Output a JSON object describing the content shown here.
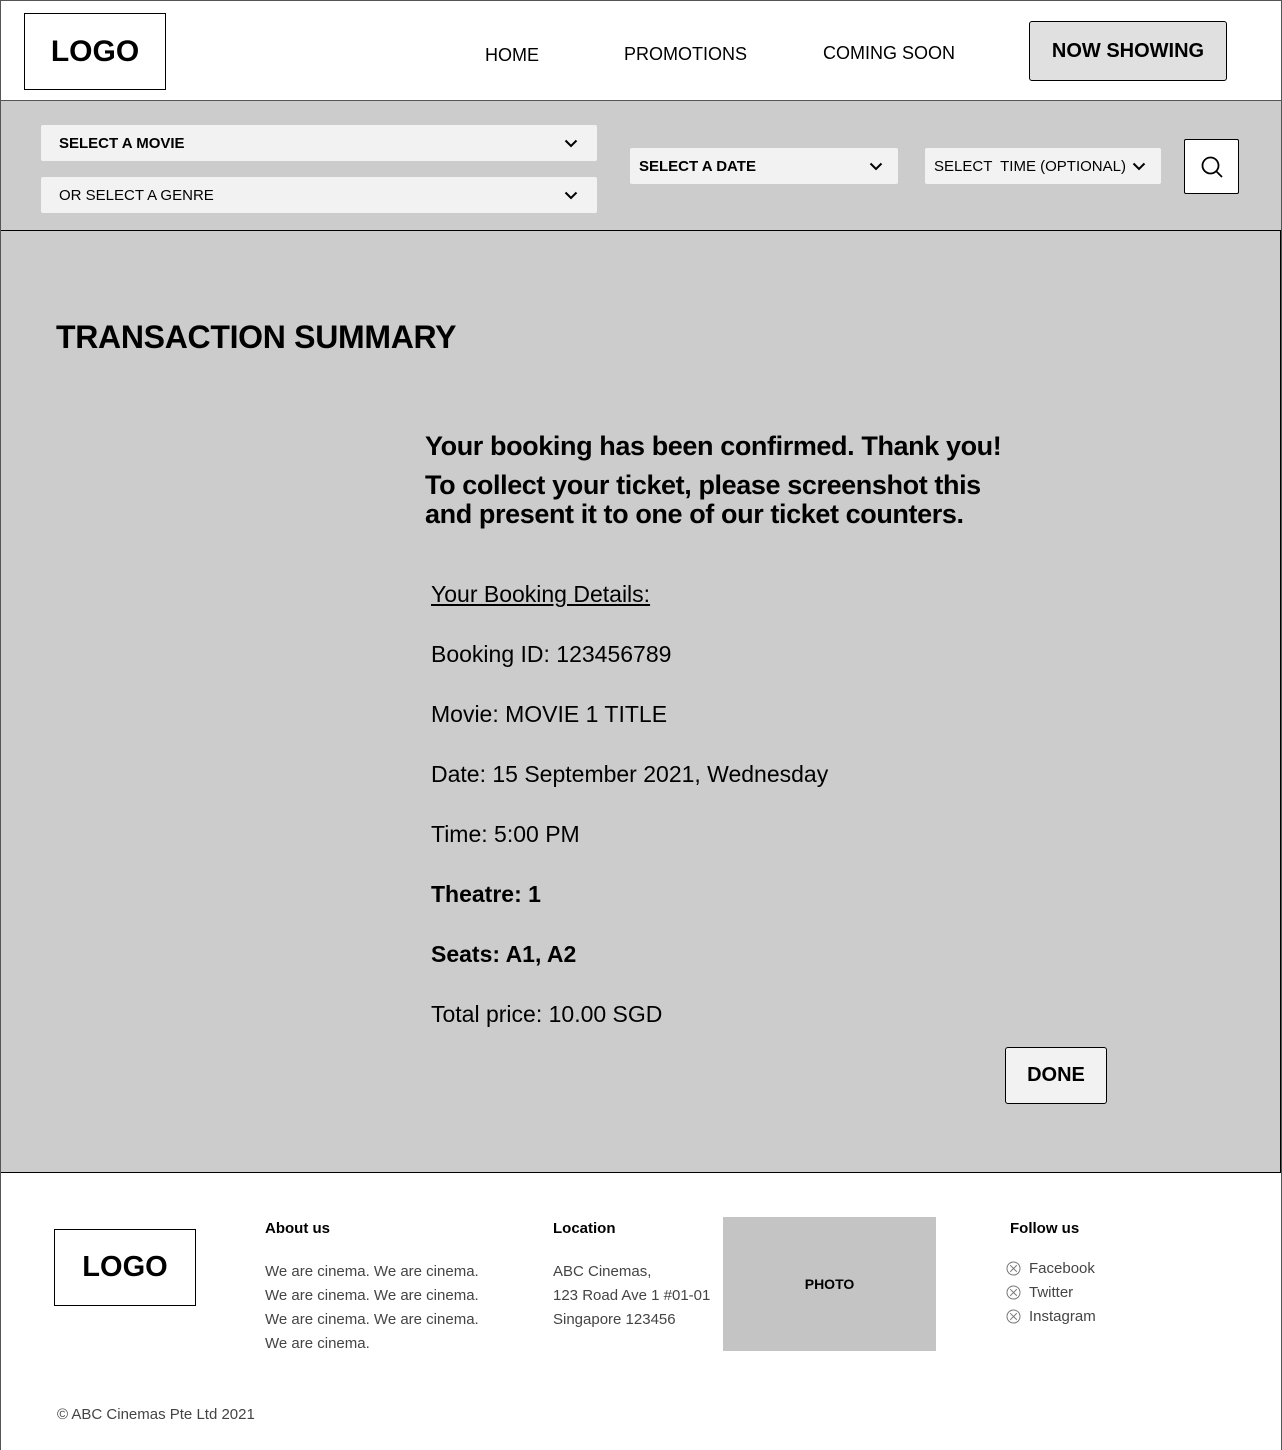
{
  "header": {
    "logo": "LOGO",
    "nav": {
      "home": "HOME",
      "promotions": "PROMOTIONS",
      "coming_soon": "COMING SOON"
    },
    "now_showing": "NOW SHOWING"
  },
  "filters": {
    "movie": "SELECT A MOVIE",
    "genre": "OR SELECT A GENRE",
    "date": "SELECT A DATE",
    "time": "SELECT  TIME (OPTIONAL)",
    "search_icon": "search-icon"
  },
  "main": {
    "title": "TRANSACTION SUMMARY",
    "confirm_line1": "Your booking has been confirmed. Thank you!",
    "confirm_line2": "To collect your ticket, please screenshot this and present it to one of our ticket counters.",
    "details_heading": "Your Booking Details:",
    "booking_id": "Booking ID: 123456789",
    "movie": "Movie: MOVIE 1 TITLE",
    "date": "Date: 15 September 2021, Wednesday",
    "time": "Time: 5:00 PM",
    "theatre": "Theatre: 1",
    "seats": "Seats: A1, A2",
    "total": "Total price: 10.00 SGD",
    "done": "DONE"
  },
  "footer": {
    "logo": "LOGO",
    "about_heading": "About us",
    "about_text": "We are cinema. We are cinema. We are cinema. We are cinema. We are cinema. We are cinema. We are cinema.",
    "location_heading": "Location",
    "location_lines": [
      "ABC Cinemas,",
      "123 Road Ave 1 #01-01",
      "Singapore 123456"
    ],
    "photo_label": "PHOTO",
    "follow_heading": "Follow us",
    "social": [
      "Facebook",
      "Twitter",
      "Instagram"
    ],
    "copyright": "© ABC Cinemas Pte Ltd 2021"
  }
}
